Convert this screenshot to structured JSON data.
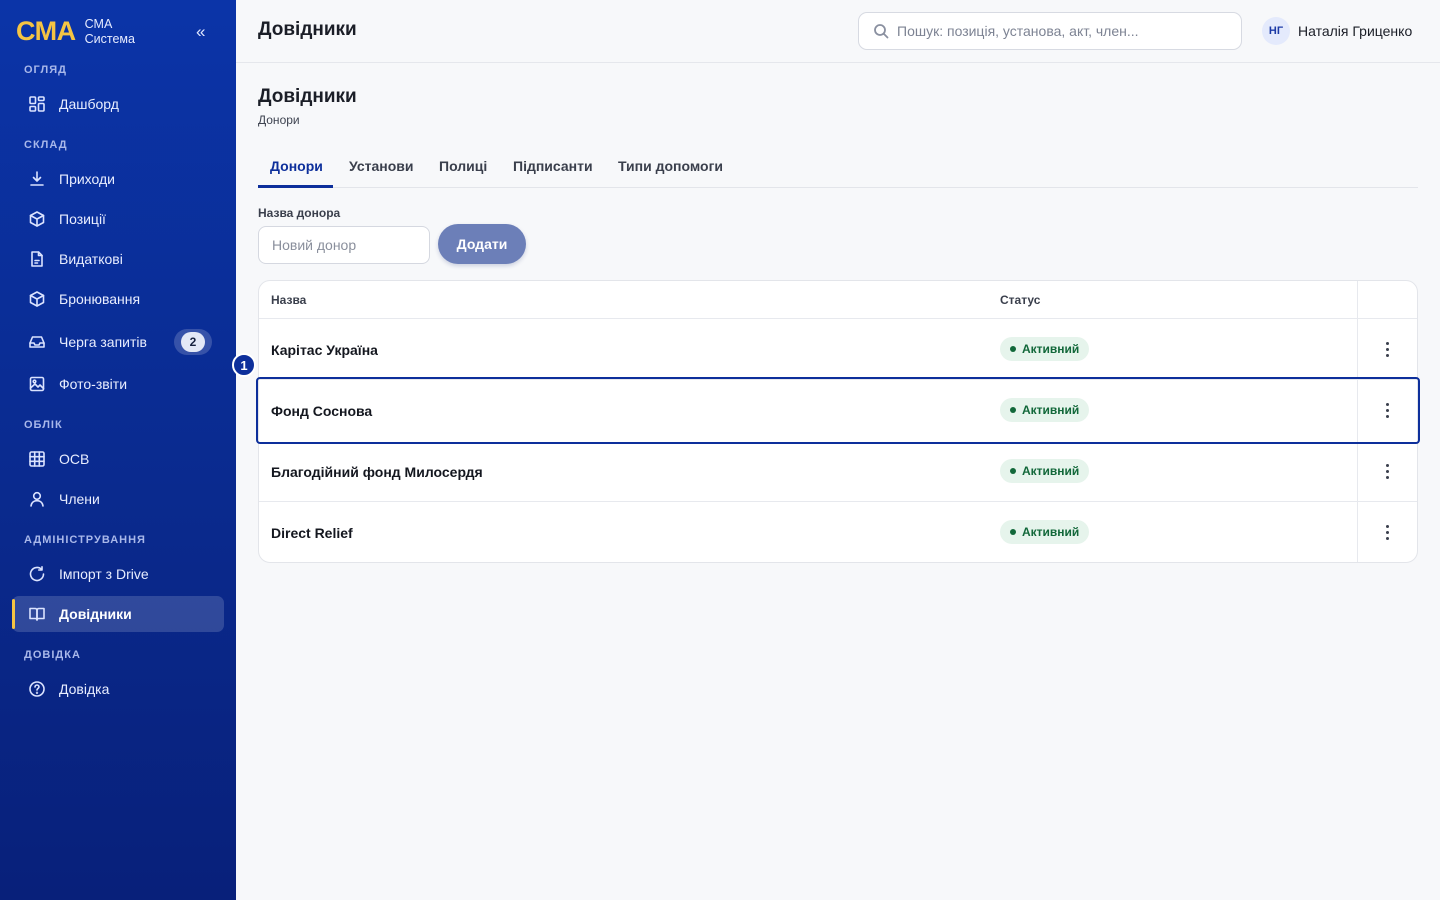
{
  "brand": {
    "logo": "СМА",
    "line1": "СМА",
    "line2": "Система"
  },
  "sidebar": {
    "collapse_label": "«",
    "sections": [
      {
        "label": "ОГЛЯД"
      },
      {
        "label": "СКЛАД"
      },
      {
        "label": "ОБЛІК"
      },
      {
        "label": "АДМІНІСТРУВАННЯ"
      },
      {
        "label": "ДОВІДКА"
      }
    ],
    "items": [
      {
        "label": "Дашборд",
        "icon": "dashboard-icon"
      },
      {
        "label": "Приходи",
        "icon": "download-icon"
      },
      {
        "label": "Позиції",
        "icon": "box-icon"
      },
      {
        "label": "Видаткові",
        "icon": "document-icon"
      },
      {
        "label": "Бронювання",
        "icon": "box-icon"
      },
      {
        "label": "Черга запитів",
        "icon": "inbox-icon",
        "badge": "2"
      },
      {
        "label": "Фото-звіти",
        "icon": "image-icon"
      },
      {
        "label": "ОСВ",
        "icon": "table-icon"
      },
      {
        "label": "Члени",
        "icon": "user-icon"
      },
      {
        "label": "Імпорт з Drive",
        "icon": "refresh-icon"
      },
      {
        "label": "Довідники",
        "icon": "book-icon",
        "active": true
      },
      {
        "label": "Довідка",
        "icon": "help-icon"
      }
    ]
  },
  "header": {
    "title": "Довідники",
    "search_placeholder": "Пошук: позиція, установа, акт, член...",
    "user_initials": "НГ",
    "user_name": "Наталія Гриценко"
  },
  "main": {
    "title": "Довідники",
    "subtitle": "Донори",
    "tabs": [
      {
        "label": "Донори",
        "active": true
      },
      {
        "label": "Установи"
      },
      {
        "label": "Полиці"
      },
      {
        "label": "Підписанти"
      },
      {
        "label": "Типи допомоги"
      }
    ],
    "form": {
      "label": "Назва донора",
      "placeholder": "Новий донор",
      "value": "",
      "add_label": "Додати"
    },
    "table": {
      "columns": [
        "Назва",
        "Статус"
      ],
      "rows": [
        {
          "name": "Карітас Україна",
          "status": "Активний"
        },
        {
          "name": "Фонд Соснова",
          "status": "Активний",
          "selected": true
        },
        {
          "name": "Благодійний фонд Милосердя",
          "status": "Активний"
        },
        {
          "name": "Direct Relief",
          "status": "Активний"
        }
      ]
    },
    "marker_label": "1"
  },
  "colors": {
    "sidebar_bg": "#0b34a8",
    "brand_accent": "#f5c443",
    "primary": "#0d2f9b",
    "button": "#6c7fb8",
    "status_bg": "#e6f4ec",
    "status_text": "#12683a"
  }
}
